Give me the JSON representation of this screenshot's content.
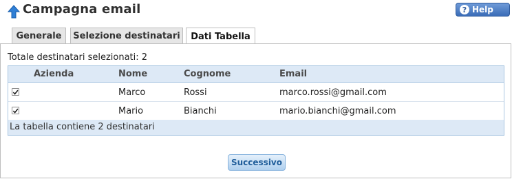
{
  "header": {
    "title": "Campagna email",
    "help_label": "Help"
  },
  "tabs": [
    {
      "label": "Generale",
      "active": false
    },
    {
      "label": "Selezione destinatari",
      "active": false
    },
    {
      "label": "Dati Tabella",
      "active": true
    }
  ],
  "summary": {
    "total_text": "Totale destinatari selezionati: 2"
  },
  "table": {
    "columns": [
      "Azienda",
      "Nome",
      "Cognome",
      "Email"
    ],
    "rows": [
      {
        "checked": true,
        "azienda": "",
        "nome": "Marco",
        "cognome": "Rossi",
        "email": "marco.rossi@gmail.com"
      },
      {
        "checked": true,
        "azienda": "",
        "nome": "Mario",
        "cognome": "Bianchi",
        "email": "mario.bianchi@gmail.com"
      }
    ],
    "footer_text": "La tabella contiene 2 destinatari"
  },
  "actions": {
    "next_label": "Successivo"
  },
  "colors": {
    "accent": "#3a6cb7",
    "header_bg": "#dde9f6",
    "next_text": "#1f5d9a"
  }
}
